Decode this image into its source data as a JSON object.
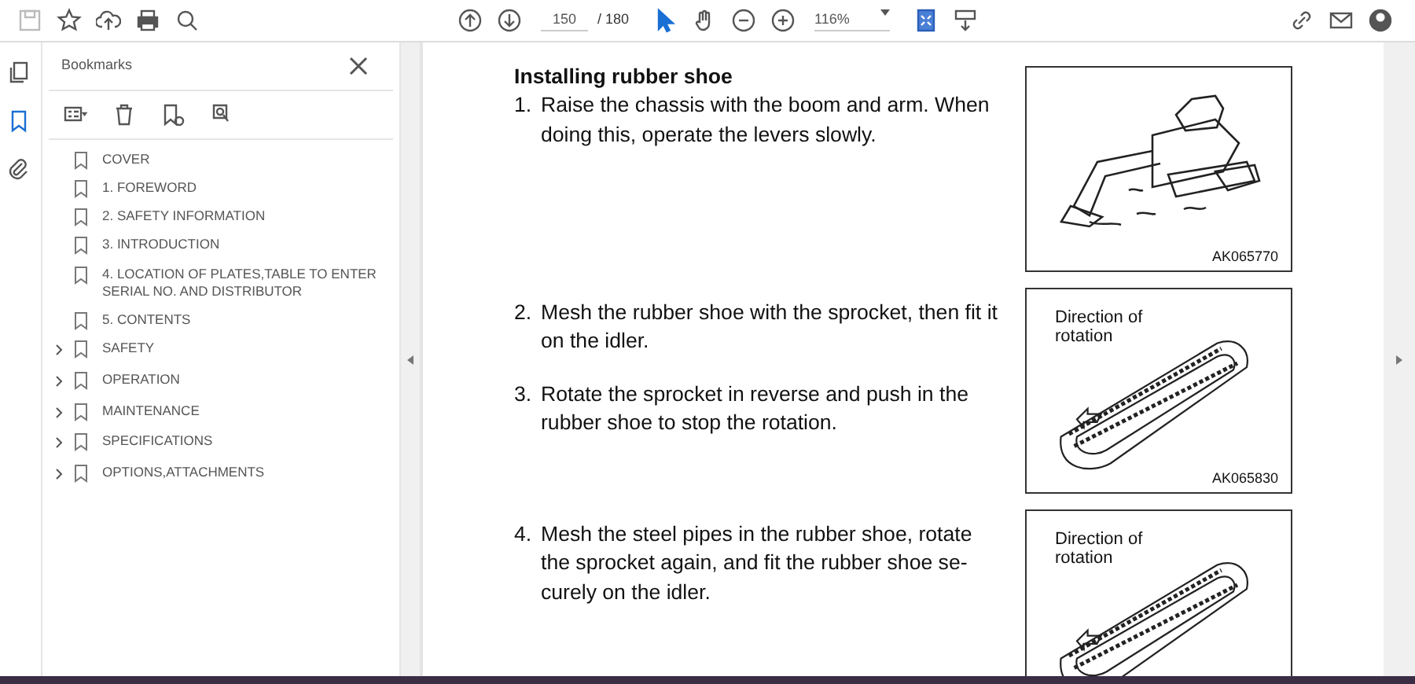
{
  "toolbar": {
    "page_number": "150",
    "page_total": "/ 180",
    "zoom": "116%",
    "tools": [
      {
        "kind": "select",
        "selected": true
      },
      {
        "kind": "hand",
        "selected": false
      }
    ]
  },
  "side_rail": [
    {
      "kind": "pages",
      "selected": false
    },
    {
      "kind": "bookmarks",
      "selected": true
    },
    {
      "kind": "attachments",
      "selected": false
    }
  ],
  "bookmarks": {
    "title": "Bookmarks",
    "items": [
      {
        "label": "COVER",
        "kind": "leaf"
      },
      {
        "label": "1. FOREWORD",
        "kind": "leaf"
      },
      {
        "label": "2. SAFETY INFORMATION",
        "kind": "leaf"
      },
      {
        "label": "3. INTRODUCTION",
        "kind": "leaf"
      },
      {
        "label": "4. LOCATION OF PLATES,TABLE TO ENTER SERIAL NO. AND DISTRIBUTOR",
        "kind": "leaf"
      },
      {
        "label": "5. CONTENTS",
        "kind": "leaf"
      },
      {
        "label": "SAFETY",
        "kind": "group",
        "expanded": false
      },
      {
        "label": "OPERATION",
        "kind": "group",
        "expanded": false
      },
      {
        "label": "MAINTENANCE",
        "kind": "group",
        "expanded": false
      },
      {
        "label": "SPECIFICATIONS",
        "kind": "group",
        "expanded": false
      },
      {
        "label": "OPTIONS,ATTACHMENTS",
        "kind": "group",
        "expanded": false
      }
    ]
  },
  "document": {
    "heading": "Installing rubber shoe",
    "steps": [
      {
        "number": "1.",
        "text": "Raise the chassis with the boom and arm. When doing this, operate the levers slowly.",
        "figure": {
          "kind": "excavator",
          "caption": "AK065770"
        }
      },
      {
        "number": "2.",
        "text": "Mesh the rubber shoe with the sprocket, then fit it on the idler.",
        "figure": {
          "kind": "track",
          "label": "Direction of rotation",
          "caption": "AK065830"
        }
      },
      {
        "number": "3.",
        "text": "Rotate the sprocket in reverse and push in the rubber shoe to stop the rotation."
      },
      {
        "number": "4.",
        "text": "Mesh the steel pipes in the rubber shoe, rotate the sprocket again, and fit the rubber shoe se-curely on the idler.",
        "figure": {
          "kind": "track",
          "label": "Direction of rotation"
        }
      }
    ]
  }
}
